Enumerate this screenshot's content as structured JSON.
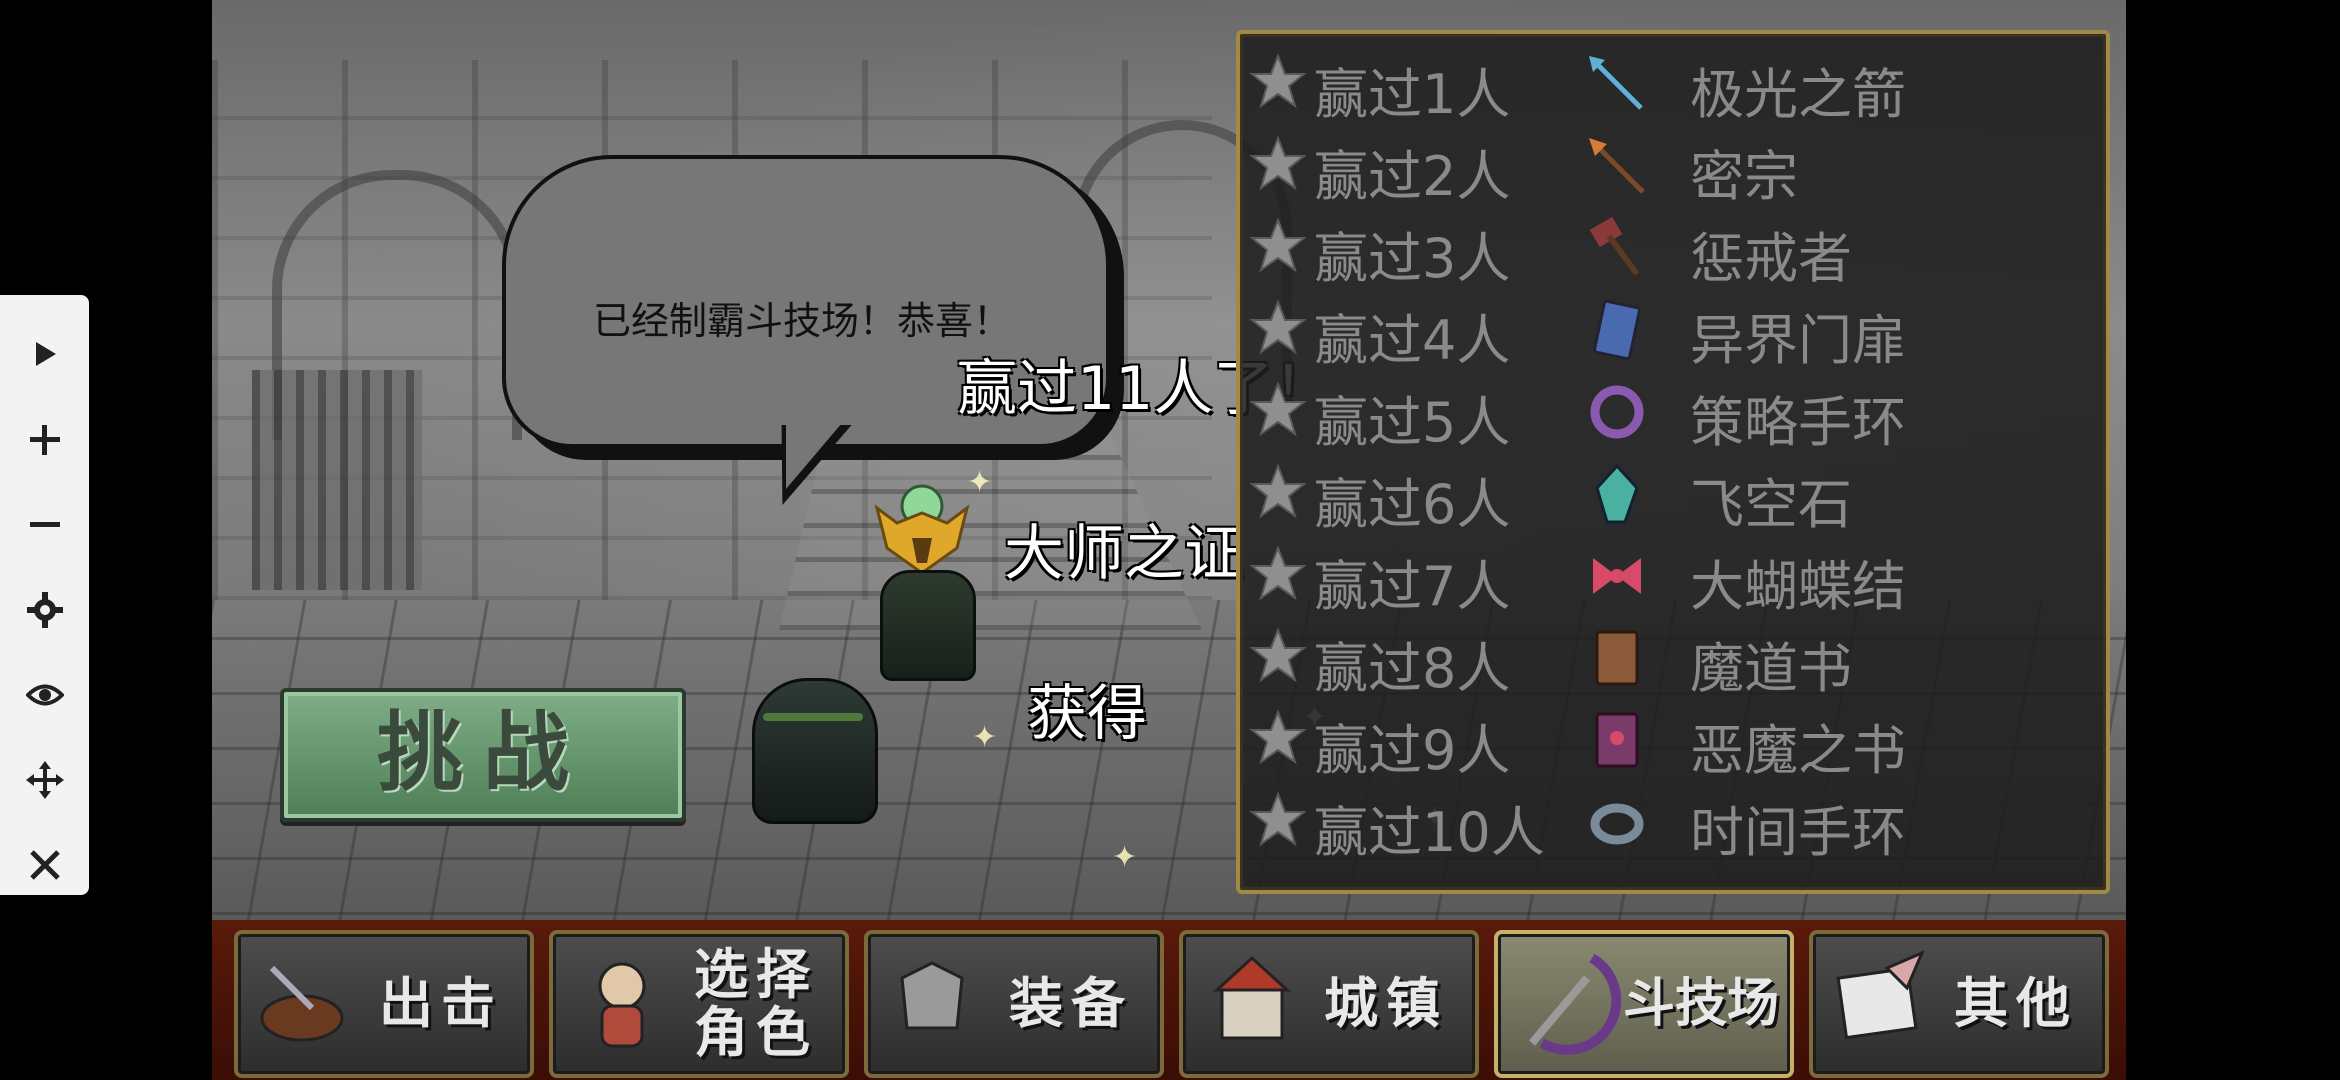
{
  "bubble": {
    "text": "已经制霸斗技场！恭喜！"
  },
  "announcement": {
    "wins": "赢过11人了！",
    "item": "大师之证",
    "obtained": "获得"
  },
  "challenge_button": {
    "label": "挑战"
  },
  "rewards": [
    {
      "condition": "赢过1人",
      "item": "极光之箭",
      "icon": "arrow-icon",
      "color": "#5fb0d8"
    },
    {
      "condition": "赢过2人",
      "item": "密宗",
      "icon": "spear-icon",
      "color": "#d87a3a"
    },
    {
      "condition": "赢过3人",
      "item": "惩戒者",
      "icon": "hammer-icon",
      "color": "#8a3a3a"
    },
    {
      "condition": "赢过4人",
      "item": "异界门扉",
      "icon": "card-icon",
      "color": "#4a6ab0"
    },
    {
      "condition": "赢过5人",
      "item": "策略手环",
      "icon": "bracelet-icon",
      "color": "#8a5ab0"
    },
    {
      "condition": "赢过6人",
      "item": "飞空石",
      "icon": "crystal-icon",
      "color": "#4ab0a0"
    },
    {
      "condition": "赢过7人",
      "item": "大蝴蝶结",
      "icon": "ribbon-icon",
      "color": "#d84a6a"
    },
    {
      "condition": "赢过8人",
      "item": "魔道书",
      "icon": "book-icon",
      "color": "#8a5a3a"
    },
    {
      "condition": "赢过9人",
      "item": "恶魔之书",
      "icon": "demon-book-icon",
      "color": "#7a3a6a"
    },
    {
      "condition": "赢过10人",
      "item": "时间手环",
      "icon": "time-bracelet-icon",
      "color": "#7a8a9a"
    }
  ],
  "menu": [
    {
      "label": "出击",
      "icon": "sortie-icon",
      "active": false
    },
    {
      "label": "选择角色",
      "icon": "character-select-icon",
      "active": false
    },
    {
      "label": "装备",
      "icon": "equipment-icon",
      "active": false
    },
    {
      "label": "城镇",
      "icon": "town-icon",
      "active": false
    },
    {
      "label": "斗技场",
      "icon": "arena-icon",
      "active": true
    },
    {
      "label": "其他",
      "icon": "other-icon",
      "active": false
    }
  ],
  "toolbar": [
    {
      "icon": "play-icon"
    },
    {
      "icon": "plus-icon"
    },
    {
      "icon": "minus-icon"
    },
    {
      "icon": "gear-icon"
    },
    {
      "icon": "eye-icon"
    },
    {
      "icon": "move-icon"
    },
    {
      "icon": "close-icon"
    }
  ]
}
